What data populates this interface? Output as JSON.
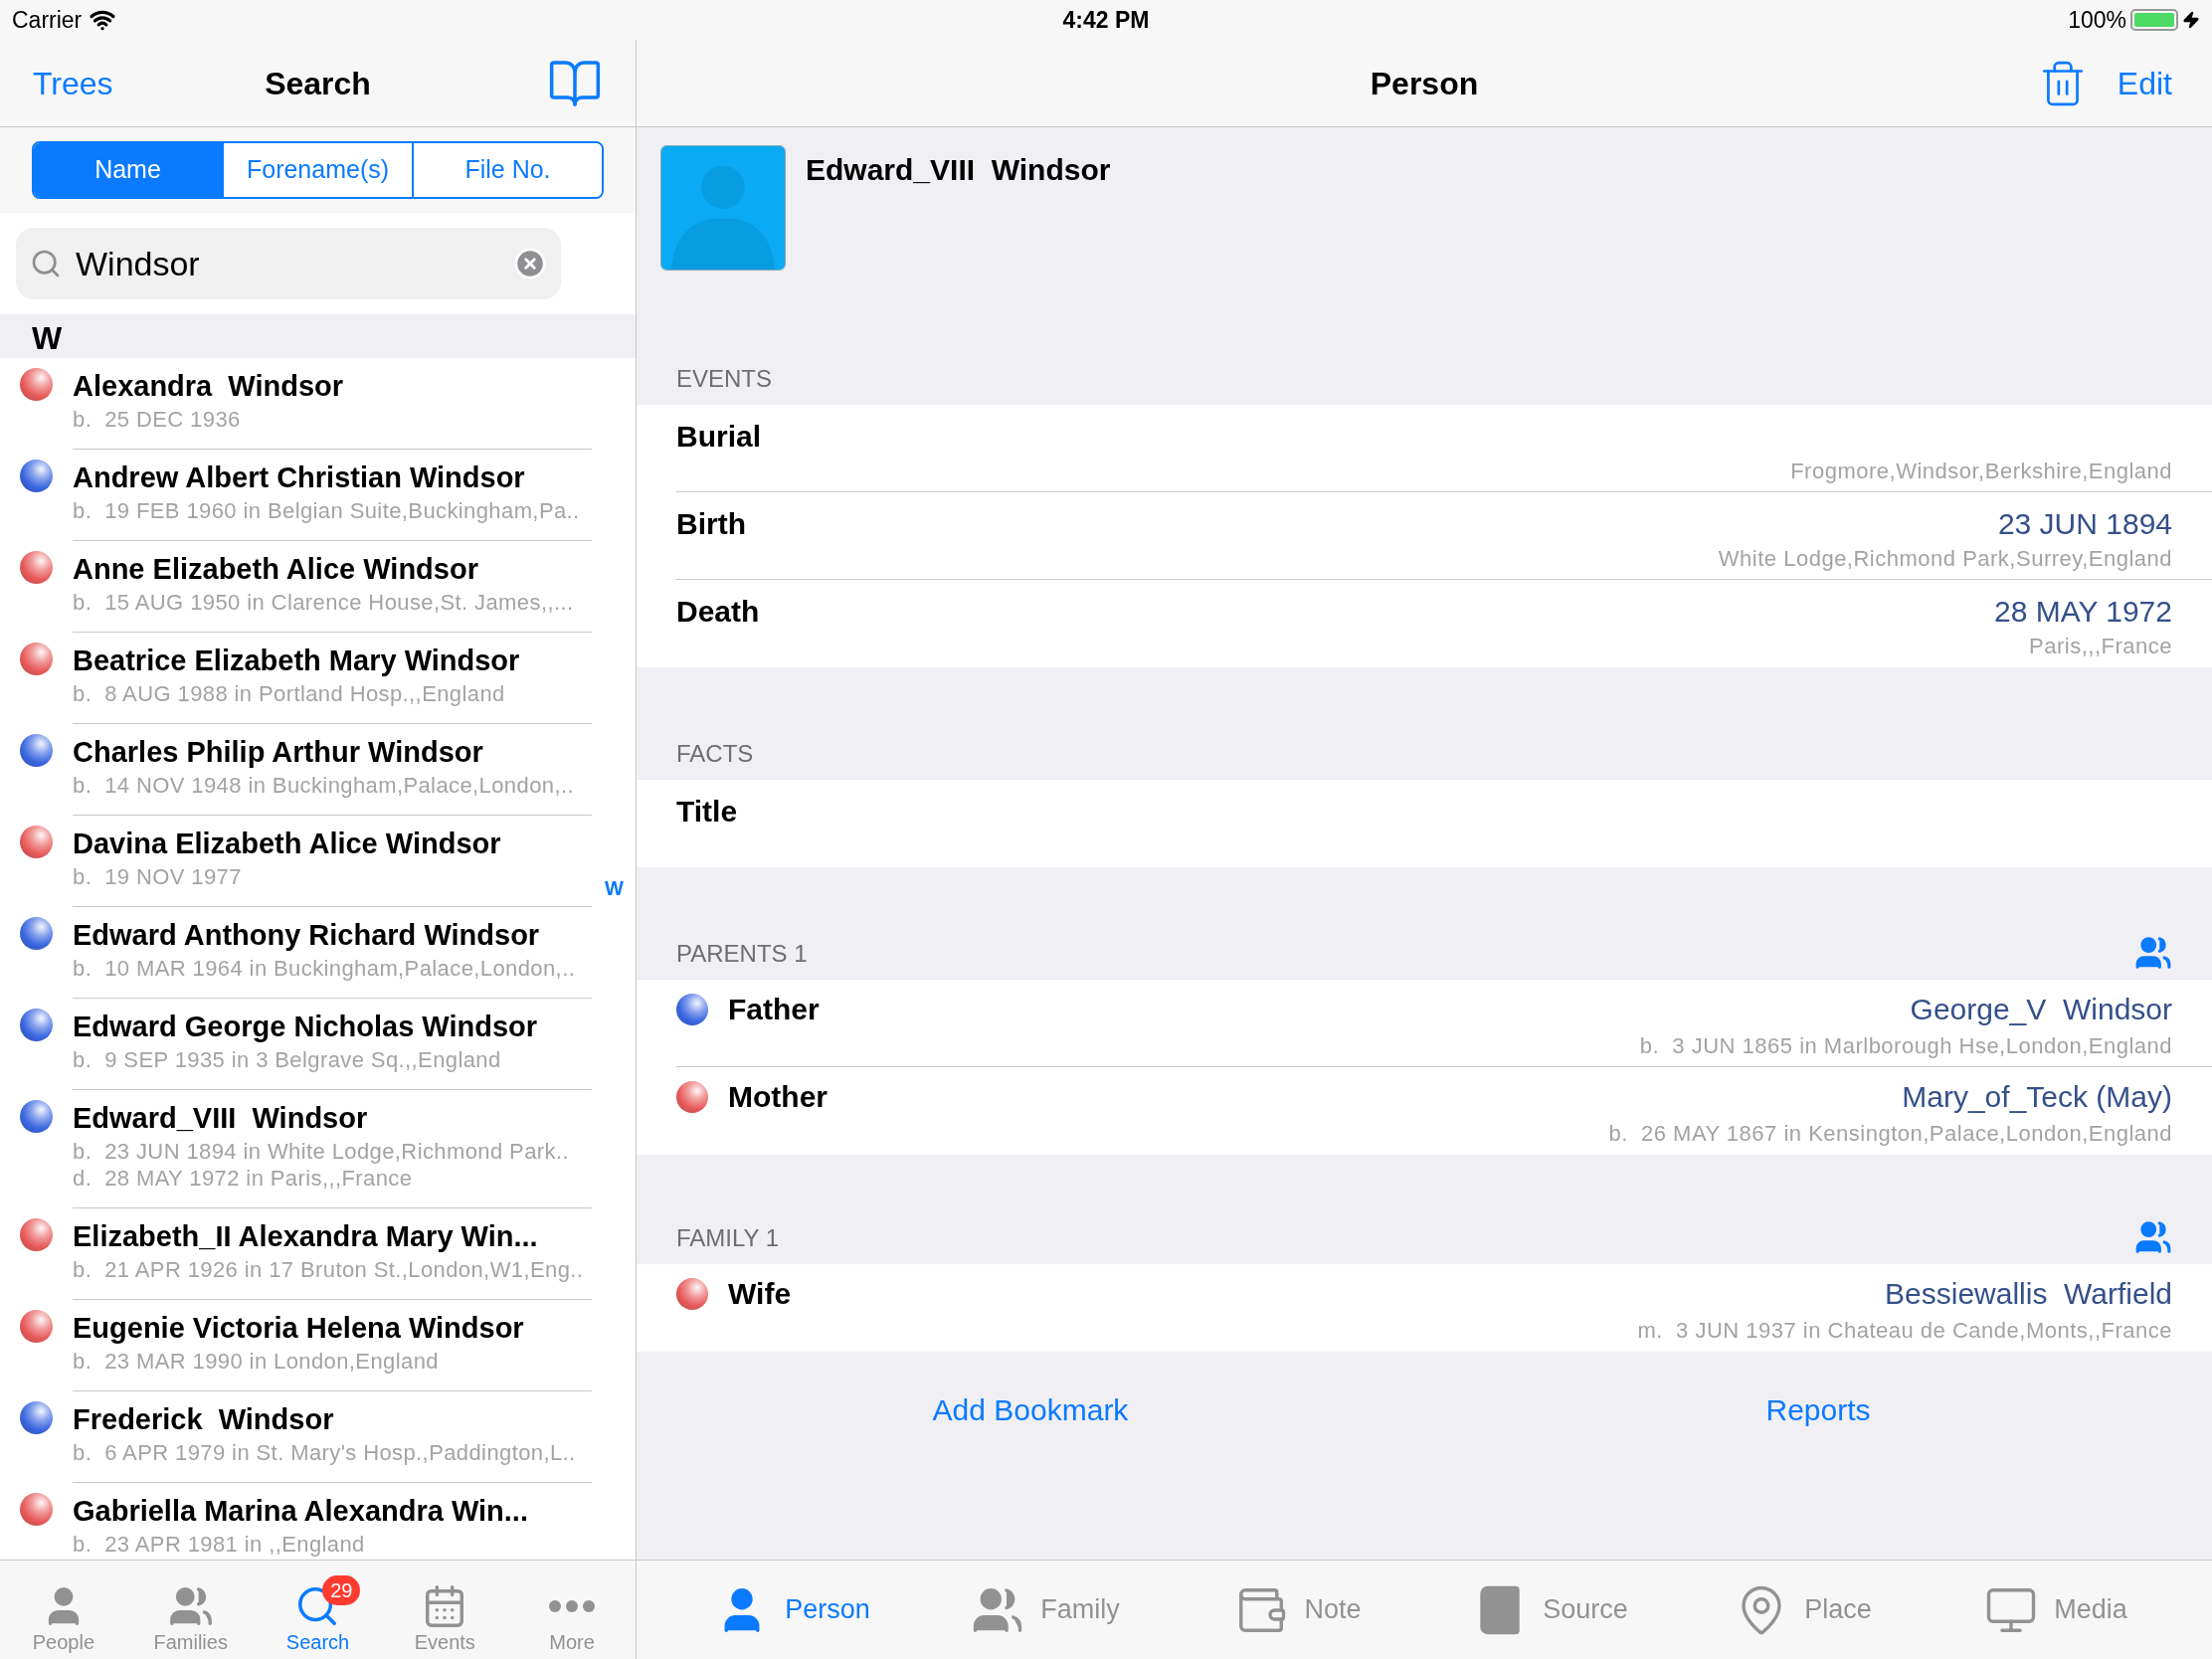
{
  "status_bar": {
    "carrier": "Carrier",
    "time": "4:42 PM",
    "battery": "100%"
  },
  "left_nav": {
    "back": "Trees",
    "title": "Search"
  },
  "segments": [
    {
      "label": "Name",
      "selected": true
    },
    {
      "label": "Forename(s)",
      "selected": false
    },
    {
      "label": "File No.",
      "selected": false
    }
  ],
  "search": {
    "value": "Windsor"
  },
  "section": "W",
  "index": [
    "W"
  ],
  "people": [
    {
      "name": "Alexandra  Windsor",
      "color": "#e85a5a",
      "lines": [
        "b.  25 DEC 1936"
      ]
    },
    {
      "name": "Andrew Albert Christian Windsor",
      "color": "#3a66e0",
      "lines": [
        "b.  19 FEB 1960 in Belgian Suite,Buckingham,Pa.."
      ]
    },
    {
      "name": "Anne Elizabeth Alice Windsor",
      "color": "#e85a5a",
      "lines": [
        "b.  15 AUG 1950 in Clarence House,St. James,,..."
      ]
    },
    {
      "name": "Beatrice Elizabeth Mary Windsor",
      "color": "#e85a5a",
      "lines": [
        "b.  8 AUG 1988 in Portland Hosp.,,England"
      ]
    },
    {
      "name": "Charles Philip Arthur Windsor",
      "color": "#3a66e0",
      "lines": [
        "b.  14 NOV 1948 in Buckingham,Palace,London,.."
      ]
    },
    {
      "name": "Davina Elizabeth Alice Windsor",
      "color": "#e85a5a",
      "lines": [
        "b.  19 NOV 1977"
      ]
    },
    {
      "name": "Edward Anthony Richard Windsor",
      "color": "#3a66e0",
      "lines": [
        "b.  10 MAR 1964 in Buckingham,Palace,London,.."
      ]
    },
    {
      "name": "Edward George Nicholas Windsor",
      "color": "#3a66e0",
      "lines": [
        "b.  9 SEP 1935 in 3 Belgrave Sq.,,England"
      ]
    },
    {
      "name": "Edward_VIII  Windsor",
      "color": "#3a66e0",
      "lines": [
        "b.  23 JUN 1894 in White Lodge,Richmond Park..",
        "d.  28 MAY 1972 in Paris,,,France"
      ]
    },
    {
      "name": "Elizabeth_II Alexandra Mary Win...",
      "color": "#e85a5a",
      "lines": [
        "b.  21 APR 1926 in 17 Bruton St.,London,W1,Eng.."
      ]
    },
    {
      "name": "Eugenie Victoria Helena Windsor",
      "color": "#e85a5a",
      "lines": [
        "b.  23 MAR 1990 in London,England"
      ]
    },
    {
      "name": "Frederick  Windsor",
      "color": "#3a66e0",
      "lines": [
        "b.  6 APR 1979 in St. Mary's Hosp.,Paddington,L.."
      ]
    },
    {
      "name": "Gabriella Marina Alexandra Win...",
      "color": "#e85a5a",
      "lines": [
        "b.  23 APR 1981 in ,,England"
      ]
    }
  ],
  "left_tabs": [
    {
      "label": "People",
      "kind": "person",
      "selected": false
    },
    {
      "label": "Families",
      "kind": "group",
      "selected": false
    },
    {
      "label": "Search",
      "kind": "search",
      "selected": true,
      "badge": "29"
    },
    {
      "label": "Events",
      "kind": "calendar",
      "selected": false
    },
    {
      "label": "More",
      "kind": "more",
      "selected": false
    }
  ],
  "right_nav": {
    "title": "Person",
    "edit": "Edit"
  },
  "person": {
    "name": "Edward_VIII  Windsor"
  },
  "events": {
    "header": "EVENTS",
    "rows": [
      {
        "label": "Burial",
        "place": "Frogmore,Windsor,Berkshire,England"
      },
      {
        "label": "Birth",
        "date": "23 JUN 1894",
        "place": "White Lodge,Richmond Park,Surrey,England"
      },
      {
        "label": "Death",
        "date": "28 MAY 1972",
        "place": "Paris,,,France"
      }
    ]
  },
  "facts": {
    "header": "FACTS",
    "rows": [
      {
        "label": "Title"
      }
    ]
  },
  "parents": {
    "header": "PARENTS 1",
    "rows": [
      {
        "role": "Father",
        "color": "#3a66e0",
        "name": "George_V  Windsor",
        "detail": "b.  3 JUN 1865 in Marlborough Hse,London,England"
      },
      {
        "role": "Mother",
        "color": "#e85a5a",
        "name": "Mary_of_Teck (May)",
        "detail": "b.  26 MAY 1867 in Kensington,Palace,London,England"
      }
    ]
  },
  "family": {
    "header": "FAMILY 1",
    "rows": [
      {
        "role": "Wife",
        "color": "#e85a5a",
        "name": "Bessiewallis  Warfield",
        "detail": "m.  3 JUN 1937 in Chateau de Cande,Monts,,France"
      }
    ]
  },
  "actions": [
    "Add Bookmark",
    "Reports"
  ],
  "right_tabs": [
    {
      "label": "Person",
      "kind": "person",
      "selected": true
    },
    {
      "label": "Family",
      "kind": "group",
      "selected": false
    },
    {
      "label": "Note",
      "kind": "wallet",
      "selected": false
    },
    {
      "label": "Source",
      "kind": "book",
      "selected": false
    },
    {
      "label": "Place",
      "kind": "pin",
      "selected": false
    },
    {
      "label": "Media",
      "kind": "monitor",
      "selected": false
    }
  ]
}
